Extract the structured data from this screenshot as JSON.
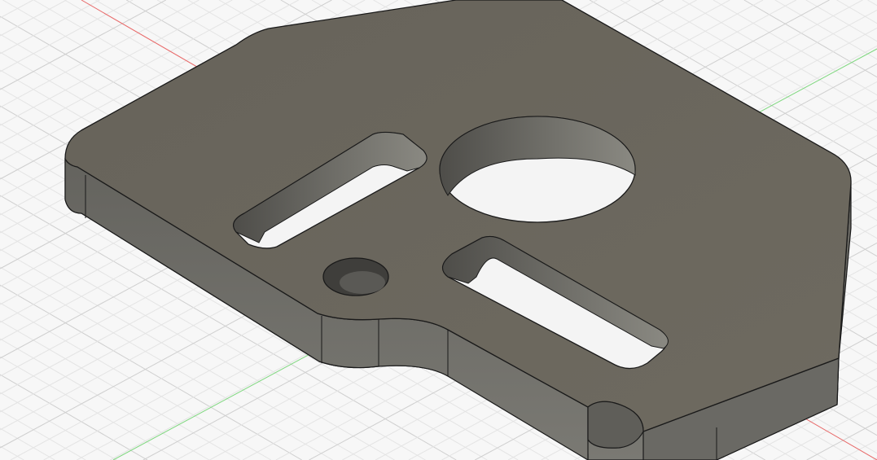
{
  "viewport": {
    "colors": {
      "background": "#f7f7f7",
      "grid_minor": "#e4e4e4",
      "grid_major": "#cfcfcf",
      "x_axis": "#e86a6a",
      "y_axis": "#7fd77f",
      "top_face": "#6a665d",
      "side_face": "#71706a",
      "edge": "#1a1a1a",
      "hole_wall": "#5e5c57"
    }
  }
}
